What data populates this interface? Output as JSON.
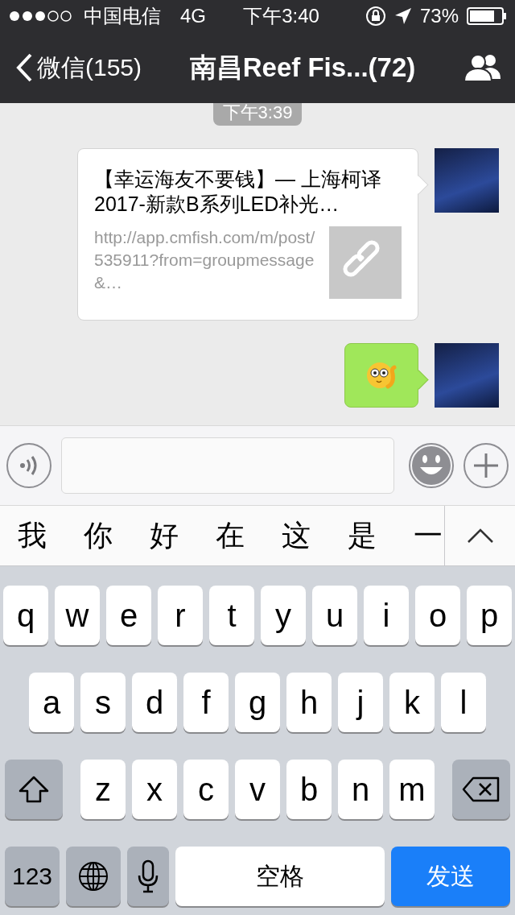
{
  "status_bar": {
    "carrier": "中国电信",
    "network": "4G",
    "time": "下午3:40",
    "battery": "73%"
  },
  "nav_bar": {
    "back_label": "微信(155)",
    "title": "南昌Reef Fis...(72)"
  },
  "chat": {
    "timestamp": "下午3:39",
    "messages": [
      {
        "kind": "link",
        "title": "【幸运海友不要钱】— 上海柯译2017-新款B系列LED补光…",
        "url": "http://app.cmfish.com/m/post/535911?from=groupmessage&…"
      },
      {
        "kind": "emoji"
      }
    ]
  },
  "candidates": [
    "我",
    "你",
    "好",
    "在",
    "这",
    "是",
    "一"
  ],
  "keyboard": {
    "rows": [
      [
        {
          "kind": "letter",
          "label": "q"
        },
        {
          "kind": "letter",
          "label": "w"
        },
        {
          "kind": "letter",
          "label": "e"
        },
        {
          "kind": "letter",
          "label": "r"
        },
        {
          "kind": "letter",
          "label": "t"
        },
        {
          "kind": "letter",
          "label": "y"
        },
        {
          "kind": "letter",
          "label": "u"
        },
        {
          "kind": "letter",
          "label": "i"
        },
        {
          "kind": "letter",
          "label": "o"
        },
        {
          "kind": "letter",
          "label": "p"
        }
      ],
      [
        {
          "kind": "letter",
          "label": "a"
        },
        {
          "kind": "letter",
          "label": "s"
        },
        {
          "kind": "letter",
          "label": "d"
        },
        {
          "kind": "letter",
          "label": "f"
        },
        {
          "kind": "letter",
          "label": "g"
        },
        {
          "kind": "letter",
          "label": "h"
        },
        {
          "kind": "letter",
          "label": "j"
        },
        {
          "kind": "letter",
          "label": "k"
        },
        {
          "kind": "letter",
          "label": "l"
        }
      ],
      [
        {
          "kind": "shift"
        },
        {
          "kind": "letter",
          "label": "z"
        },
        {
          "kind": "letter",
          "label": "x"
        },
        {
          "kind": "letter",
          "label": "c"
        },
        {
          "kind": "letter",
          "label": "v"
        },
        {
          "kind": "letter",
          "label": "b"
        },
        {
          "kind": "letter",
          "label": "n"
        },
        {
          "kind": "letter",
          "label": "m"
        },
        {
          "kind": "backspace"
        }
      ]
    ],
    "bottom_row": [
      {
        "kind": "mode",
        "label": "123"
      },
      {
        "kind": "globe"
      },
      {
        "kind": "mic"
      },
      {
        "kind": "space",
        "label": "空格"
      },
      {
        "kind": "send",
        "label": "发送"
      }
    ]
  }
}
